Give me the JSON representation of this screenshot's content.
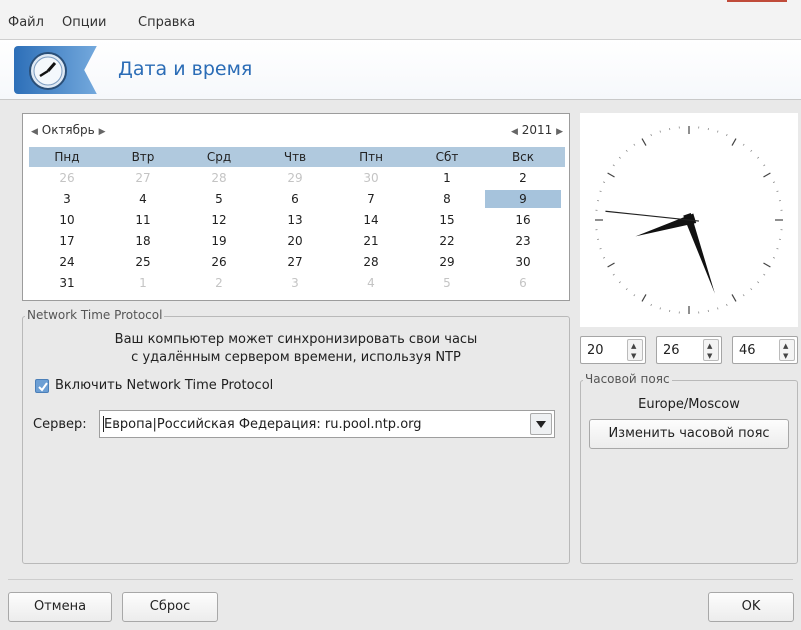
{
  "menu": {
    "file": "Файл",
    "options": "Опции",
    "help": "Справка"
  },
  "header": {
    "title": "Дата и время",
    "icon": "clock-logo-icon"
  },
  "calendar": {
    "month": "Октябрь",
    "year": "2011",
    "weekdays": [
      "Пнд",
      "Втр",
      "Срд",
      "Чтв",
      "Птн",
      "Сбт",
      "Вск"
    ],
    "weeks": [
      [
        "26",
        "27",
        "28",
        "29",
        "30",
        "1",
        "2"
      ],
      [
        "3",
        "4",
        "5",
        "6",
        "7",
        "8",
        "9"
      ],
      [
        "10",
        "11",
        "12",
        "13",
        "14",
        "15",
        "16"
      ],
      [
        "17",
        "18",
        "19",
        "20",
        "21",
        "22",
        "23"
      ],
      [
        "24",
        "25",
        "26",
        "27",
        "28",
        "29",
        "30"
      ],
      [
        "31",
        "1",
        "2",
        "3",
        "4",
        "5",
        "6"
      ]
    ],
    "selected_day": "9"
  },
  "time": {
    "hours": "20",
    "minutes": "26",
    "seconds": "46"
  },
  "ntp": {
    "group_title": "Network Time Protocol",
    "description_line1": "Ваш компьютер может синхронизировать свои часы",
    "description_line2": "с удалённым сервером времени, используя NTP",
    "enable_label": "Включить Network Time Protocol",
    "enabled": true,
    "server_label": "Сервер:",
    "server_value": "Европа|Российская Федерация: ru.pool.ntp.org"
  },
  "timezone": {
    "group_title": "Часовой пояс",
    "value": "Europe/Moscow",
    "change_button": "Изменить часовой пояс"
  },
  "buttons": {
    "cancel": "Отмена",
    "reset": "Сброс",
    "ok": "OK"
  },
  "colors": {
    "accent": "#2b6cb6",
    "selection": "#a6c3dc",
    "header_row": "#b0c9de"
  }
}
